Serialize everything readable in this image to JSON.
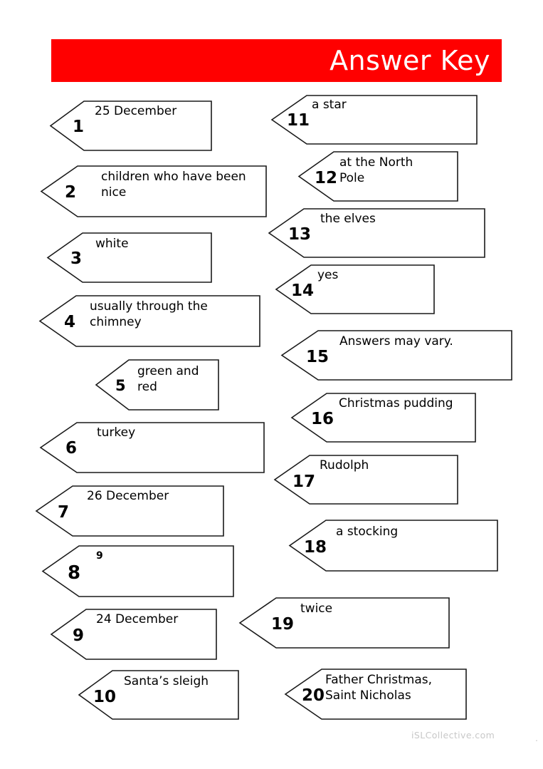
{
  "page": {
    "title": "Answer Key",
    "banner_color": "#ff0000",
    "banner_text_color": "#ffffff",
    "background_color": "#ffffff"
  },
  "watermark": {
    "text": "iSLCollective.com",
    "dot": ".",
    "color": "#c8c8c8"
  },
  "answers": [
    {
      "number": "1",
      "text": "25 December"
    },
    {
      "number": "2",
      "text": "children who have been\nnice"
    },
    {
      "number": "3",
      "text": "white"
    },
    {
      "number": "4",
      "text": "usually through the\nchimney"
    },
    {
      "number": "5",
      "text": "green and red"
    },
    {
      "number": "6",
      "text": "turkey"
    },
    {
      "number": "7",
      "text": "26 December"
    },
    {
      "number": "8",
      "text": "9"
    },
    {
      "number": "9",
      "text": "24 December"
    },
    {
      "number": "10",
      "text": "Santa’s sleigh"
    },
    {
      "number": "11",
      "text": "a star"
    },
    {
      "number": "12",
      "text": "at the North\nPole"
    },
    {
      "number": "13",
      "text": "the elves"
    },
    {
      "number": "14",
      "text": "yes"
    },
    {
      "number": "15",
      "text": "Answers may vary."
    },
    {
      "number": "16",
      "text": "Christmas pudding"
    },
    {
      "number": "17",
      "text": "Rudolph"
    },
    {
      "number": "18",
      "text": "a stocking"
    },
    {
      "number": "19",
      "text": "twice"
    },
    {
      "number": "20",
      "text": "Father Christmas,\nSaint Nicholas"
    }
  ]
}
